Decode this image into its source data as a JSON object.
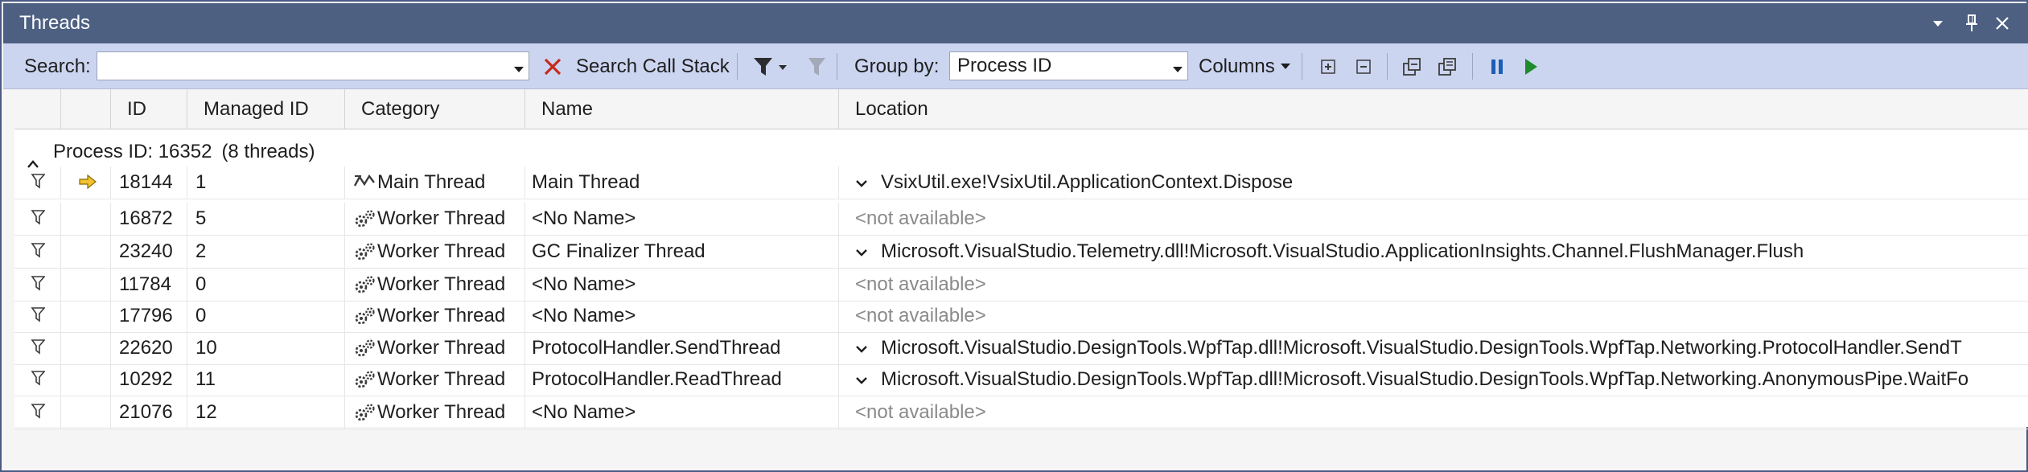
{
  "window": {
    "title": "Threads"
  },
  "toolbar": {
    "search_label": "Search:",
    "search_value": "",
    "search_call_stack": "Search Call Stack",
    "group_by_label": "Group by:",
    "group_by_value": "Process ID",
    "columns_label": "Columns"
  },
  "columns": {
    "id": "ID",
    "managed_id": "Managed ID",
    "category": "Category",
    "name": "Name",
    "location": "Location"
  },
  "group": {
    "label": "Process ID: 16352",
    "count": "(8 threads)"
  },
  "rows": [
    {
      "id": "18144",
      "managed_id": "1",
      "category": "Main Thread",
      "name": "Main Thread",
      "location": "VsixUtil.exe!VsixUtil.ApplicationContext.Dispose",
      "current": true
    },
    {
      "id": "16872",
      "managed_id": "5",
      "category": "Worker Thread",
      "name": "<No Name>",
      "location": "<not available>"
    },
    {
      "id": "23240",
      "managed_id": "2",
      "category": "Worker Thread",
      "name": "GC Finalizer Thread",
      "location": "Microsoft.VisualStudio.Telemetry.dll!Microsoft.VisualStudio.ApplicationInsights.Channel.FlushManager.Flush"
    },
    {
      "id": "11784",
      "managed_id": "0",
      "category": "Worker Thread",
      "name": "<No Name>",
      "location": "<not available>"
    },
    {
      "id": "17796",
      "managed_id": "0",
      "category": "Worker Thread",
      "name": "<No Name>",
      "location": "<not available>"
    },
    {
      "id": "22620",
      "managed_id": "10",
      "category": "Worker Thread",
      "name": "ProtocolHandler.SendThread",
      "location": "Microsoft.VisualStudio.DesignTools.WpfTap.dll!Microsoft.VisualStudio.DesignTools.WpfTap.Networking.ProtocolHandler.SendT"
    },
    {
      "id": "10292",
      "managed_id": "11",
      "category": "Worker Thread",
      "name": "ProtocolHandler.ReadThread",
      "location": "Microsoft.VisualStudio.DesignTools.WpfTap.dll!Microsoft.VisualStudio.DesignTools.WpfTap.Networking.AnonymousPipe.WaitFo"
    },
    {
      "id": "21076",
      "managed_id": "12",
      "category": "Worker Thread",
      "name": "<No Name>",
      "location": "<not available>"
    }
  ],
  "colors": {
    "title_bar": "#4d6082",
    "toolbar": "#ccd5f0",
    "play_green": "#1e8c2b",
    "pause_blue": "#1b5fb4",
    "delete_red": "#c42b1c"
  }
}
